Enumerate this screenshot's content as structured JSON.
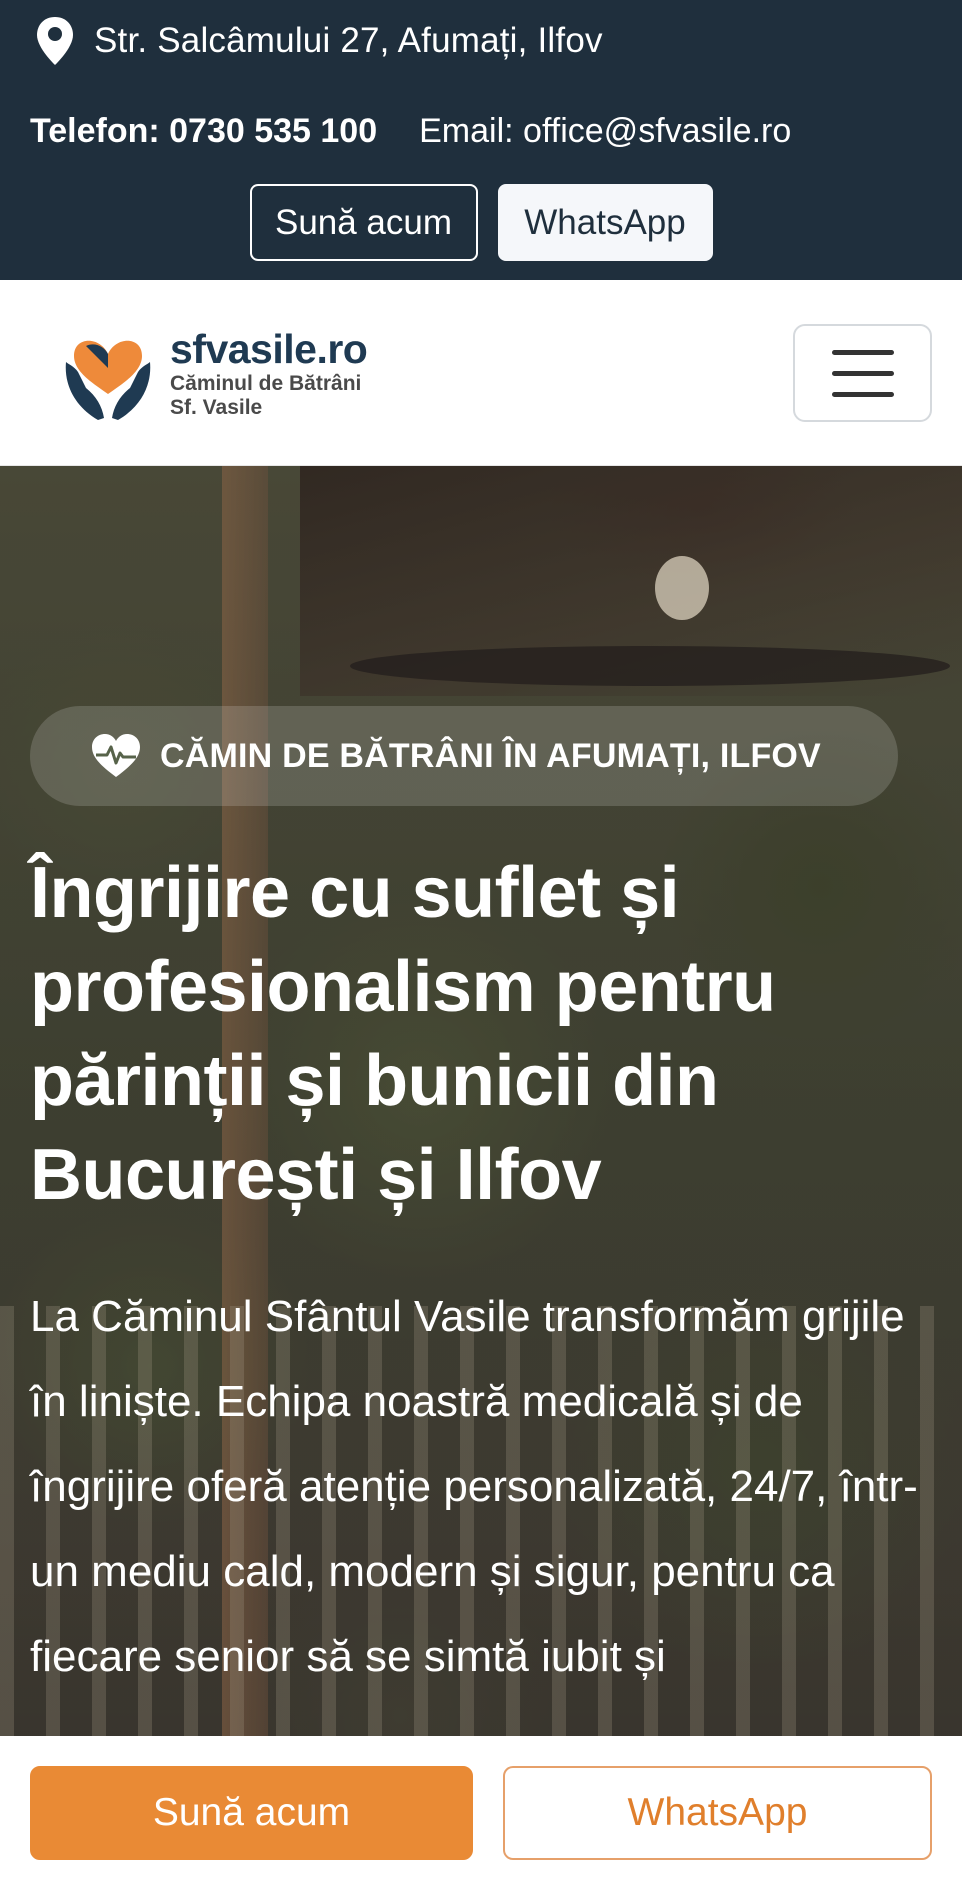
{
  "topbar": {
    "address": "Str. Salcâmului 27, Afumați, Ilfov",
    "phone": "Telefon: 0730 535 100",
    "email": "Email: office@sfvasile.ro",
    "call_label": "Sună acum",
    "whatsapp_label": "WhatsApp",
    "bg_color": "#1f2f3d"
  },
  "header": {
    "logo_name": "sfvasile.ro",
    "logo_tagline_1": "Căminul de Bătrâni",
    "logo_tagline_2": "Sf. Vasile",
    "menu_icon": "hamburger-menu-icon"
  },
  "hero": {
    "badge": "CĂMIN DE BĂTRÂNI ÎN AFUMAȚI, ILFOV",
    "badge_icon": "heart-pulse-icon",
    "title": "Îngrijire cu suflet și profesionalism pentru părinții și bunicii din București și Ilfov",
    "text": "La Căminul Sfântul Vasile transformăm grijile în liniște. Echipa noastră medicală și de îngrijire oferă atenție personalizată, 24/7, într-un mediu cald, modern și sigur, pentru ca fiecare senior să se simtă iubit și"
  },
  "bottom_bar": {
    "call_label": "Sună acum",
    "whatsapp_label": "WhatsApp",
    "accent_color": "#e98a35"
  }
}
